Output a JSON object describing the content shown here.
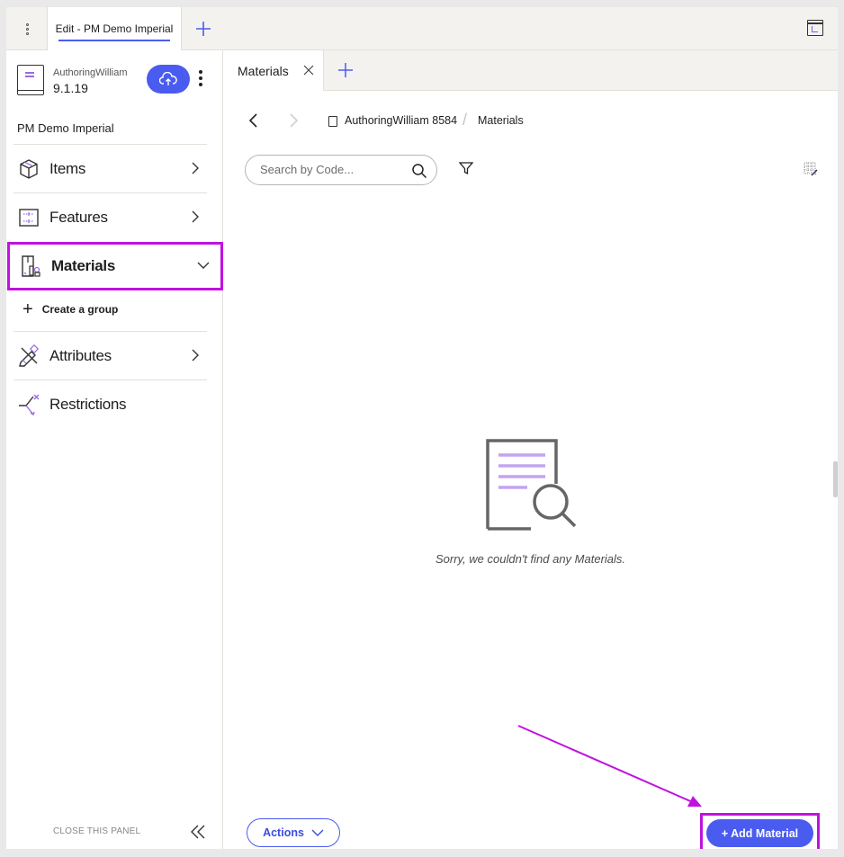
{
  "topbar": {
    "tab_label": "Edit - PM Demo Imperial",
    "menu_icon": "vertical-dots-icon",
    "add_tab_icon": "plus-icon",
    "expand_icon": "expand-window-icon"
  },
  "sidebar": {
    "owner": "AuthoringWilliam",
    "version": "9.1.19",
    "project_name": "PM Demo Imperial",
    "items": [
      {
        "label": "Items",
        "icon": "cube-icon",
        "expanded": false
      },
      {
        "label": "Features",
        "icon": "features-icon",
        "expanded": false
      },
      {
        "label": "Materials",
        "icon": "materials-icon",
        "expanded": true
      },
      {
        "label": "Attributes",
        "icon": "attributes-icon",
        "expanded": false
      },
      {
        "label": "Restrictions",
        "icon": "restrictions-icon",
        "expanded": false
      }
    ],
    "create_group_label": "Create a group",
    "close_panel_label": "CLOSE THIS PANEL"
  },
  "main": {
    "tab_label": "Materials",
    "breadcrumb": {
      "root": "AuthoringWilliam 8584",
      "current": "Materials"
    },
    "search": {
      "placeholder": "Search by Code..."
    },
    "empty_message": "Sorry, we couldn't find any Materials.",
    "actions_label": "Actions",
    "add_label": "+ Add Material"
  },
  "colors": {
    "accent": "#4a5cf0",
    "highlight": "#c012e0",
    "icon_purple": "#9a6ae6"
  }
}
